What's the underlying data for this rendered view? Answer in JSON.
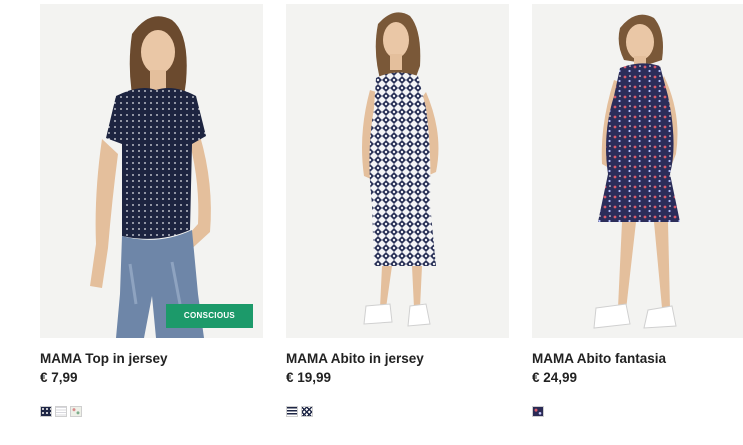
{
  "products": [
    {
      "title": "MAMA Top in jersey",
      "price": "€ 7,99",
      "badge": "CONSCIOUS",
      "swatches": [
        "navy-dots",
        "grey-stripes",
        "floral-light"
      ]
    },
    {
      "title": "MAMA Abito in jersey",
      "price": "€ 19,99",
      "swatches": [
        "navy-stripes",
        "navy-geo"
      ]
    },
    {
      "title": "MAMA Abito fantasia",
      "price": "€ 24,99",
      "swatches": [
        "navy-floral"
      ]
    }
  ],
  "colors": {
    "badge_green": "#1c9a6a",
    "text": "#222222",
    "image_background": "#f3f3f1"
  }
}
